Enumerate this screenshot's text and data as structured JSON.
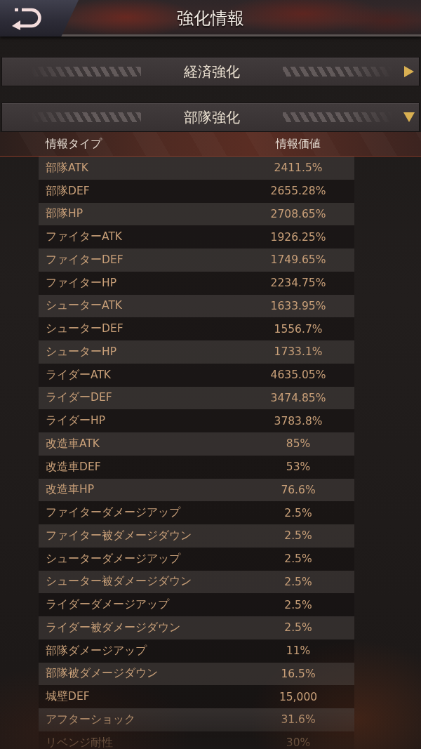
{
  "header": {
    "title": "強化情報"
  },
  "sections": [
    {
      "title": "経済強化",
      "expanded": false
    },
    {
      "title": "部隊強化",
      "expanded": true,
      "table": {
        "columns": [
          "情報タイプ",
          "情報価値"
        ],
        "rows": [
          {
            "type": "部隊ATK",
            "value": "2411.5%"
          },
          {
            "type": "部隊DEF",
            "value": "2655.28%"
          },
          {
            "type": "部隊HP",
            "value": "2708.65%"
          },
          {
            "type": "ファイターATK",
            "value": "1926.25%"
          },
          {
            "type": "ファイターDEF",
            "value": "1749.65%"
          },
          {
            "type": "ファイターHP",
            "value": "2234.75%"
          },
          {
            "type": "シューターATK",
            "value": "1633.95%"
          },
          {
            "type": "シューターDEF",
            "value": "1556.7%"
          },
          {
            "type": "シューターHP",
            "value": "1733.1%"
          },
          {
            "type": "ライダーATK",
            "value": "4635.05%"
          },
          {
            "type": "ライダーDEF",
            "value": "3474.85%"
          },
          {
            "type": "ライダーHP",
            "value": "3783.8%"
          },
          {
            "type": "改造車ATK",
            "value": "85%"
          },
          {
            "type": "改造車DEF",
            "value": "53%"
          },
          {
            "type": "改造車HP",
            "value": "76.6%"
          },
          {
            "type": "ファイターダメージアップ",
            "value": "2.5%"
          },
          {
            "type": "ファイター被ダメージダウン",
            "value": "2.5%"
          },
          {
            "type": "シューターダメージアップ",
            "value": "2.5%"
          },
          {
            "type": "シューター被ダメージダウン",
            "value": "2.5%"
          },
          {
            "type": "ライダーダメージアップ",
            "value": "2.5%"
          },
          {
            "type": "ライダー被ダメージダウン",
            "value": "2.5%"
          },
          {
            "type": "部隊ダメージアップ",
            "value": "11%"
          },
          {
            "type": "部隊被ダメージダウン",
            "value": "16.5%"
          },
          {
            "type": "城壁DEF",
            "value": "15,000"
          },
          {
            "type": "アフターショック",
            "value": "31.6%"
          },
          {
            "type": "リベンジ耐性",
            "value": "30%"
          }
        ]
      }
    }
  ]
}
